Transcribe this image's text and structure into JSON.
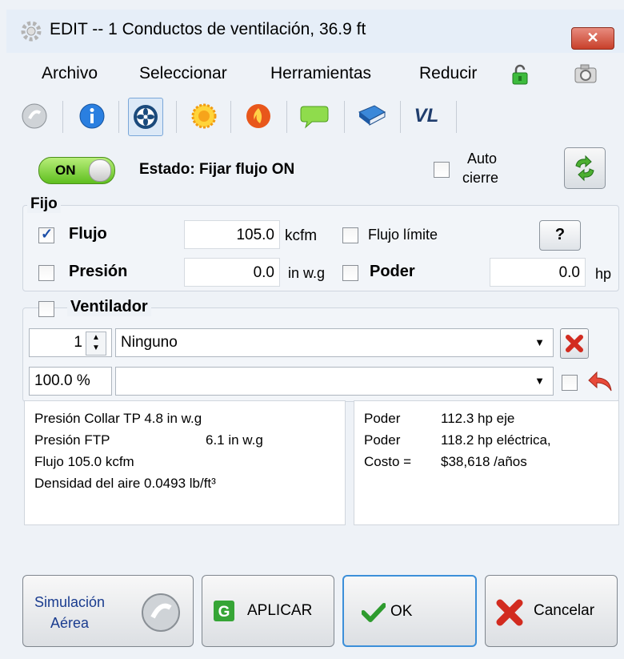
{
  "window": {
    "title": "EDIT -- 1 Conductos de ventilación, 36.9 ft",
    "close_label": "✕"
  },
  "menu": {
    "items": [
      "Archivo",
      "Seleccionar",
      "Herramientas",
      "Reducir"
    ]
  },
  "toolbar": {
    "icons": [
      "simulation-icon",
      "info-icon",
      "fan-icon",
      "sun-icon",
      "fire-icon",
      "speech-bubble-icon",
      "book-icon",
      "vl-logo-icon"
    ],
    "vl_text": "VL"
  },
  "status": {
    "toggle_label": "ON",
    "estado_text": "Estado: Fijar flujo ON",
    "auto_line1": "Auto",
    "auto_line2": "cierre"
  },
  "fijo": {
    "legend": "Fijo",
    "flujo_label": "Flujo",
    "flujo_value": "105.0",
    "flujo_unit": "kcfm",
    "flujo_checked": true,
    "flujo_limite_label": "Flujo límite",
    "help_label": "?",
    "presion_label": "Presión",
    "presion_value": "0.0",
    "presion_unit": "in w.g",
    "poder_label": "Poder",
    "poder_value": "0.0",
    "poder_unit": "hp"
  },
  "ventilador": {
    "legend": "Ventilador",
    "count_value": "1",
    "selection": "Ninguno",
    "percent_value": "100.0 %",
    "second_selection": ""
  },
  "results_left": {
    "line1": "Presión  Collar TP 4.8 in w.g",
    "line2_a": "Presión  FTP",
    "line2_b": "6.1 in w.g",
    "line3": "Flujo 105.0 kcfm",
    "line4": "Densidad del aire 0.0493 lb/ft³"
  },
  "results_right": {
    "row1_label": "Poder",
    "row1_value": "112.3 hp eje",
    "row2_label": "Poder",
    "row2_value": "118.2 hp eléctrica,",
    "row3_label": "Costo =",
    "row3_value": "$38,618 /años"
  },
  "buttons": {
    "sim_line1": "Simulación",
    "sim_line2": "Aérea",
    "apply_label": "APLICAR",
    "ok_label": "OK",
    "cancel_label": "Cancelar"
  },
  "colors": {
    "accent_blue": "#1d4fa8",
    "toggle_green": "#5fbf1f",
    "cancel_red": "#d22b1f",
    "ok_green": "#2e9b2e"
  }
}
